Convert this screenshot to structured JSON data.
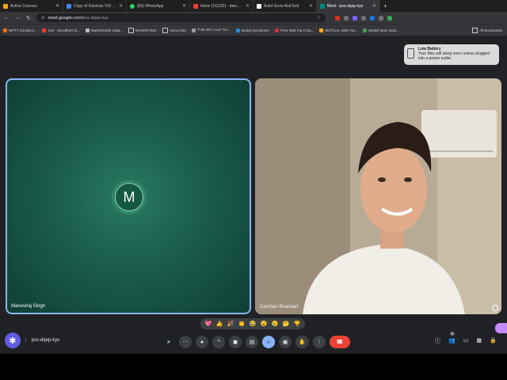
{
  "browser": {
    "tabs": [
      {
        "label": "Active Courses",
        "color": "#f6a623",
        "active": false
      },
      {
        "label": "Copy of Darshan VSI - Go",
        "color": "#4285f4",
        "active": false
      },
      {
        "label": "(83) WhatsApp",
        "color": "#25d366",
        "active": false
      },
      {
        "label": "Inbox (18,533) - darshan",
        "color": "#ea4335",
        "active": false
      },
      {
        "label": "Build Grow And Exit",
        "color": "#ffffff",
        "active": false
      },
      {
        "label": "Meet - pss-dqep-kys",
        "color": "#00897b",
        "active": true
      }
    ],
    "url_domain": "meet.google.com/",
    "url_path": "pss-dqep-kys",
    "bookmarks": [
      "NIFTY 24,600.0...",
      "Kite - Zerodha's fa...",
      "MarketSmith India...",
      "MARKETING",
      "ANALYSIS",
      "₹ 55,462 | Live Tra...",
      "Multyfi Backtester",
      "Free NSE F& O Da...",
      "MOTILAL Web Tra...",
      "Multyfi Main Strat..."
    ],
    "all_bookmarks": "All Bookmarks"
  },
  "notification": {
    "title": "Low Battery",
    "body": "Your Mac will sleep soon unless plugged into a power outlet."
  },
  "meeting": {
    "participants": [
      {
        "name": "Manoviraj Singh",
        "initial": "M"
      },
      {
        "name": "Darshan Bhandari"
      }
    ],
    "code": "pss-dqep-kys",
    "reactions": [
      "💖",
      "👍",
      "🎉",
      "👏",
      "😂",
      "😮",
      "😢",
      "🤔",
      "👎"
    ],
    "people_count": "2"
  },
  "icons": {
    "leave": "☎",
    "raise_hand": "✋",
    "more": "⋮",
    "present": "▣",
    "emoji": "☺",
    "captions": "▤",
    "camera": "◼",
    "mic": "🎙"
  }
}
